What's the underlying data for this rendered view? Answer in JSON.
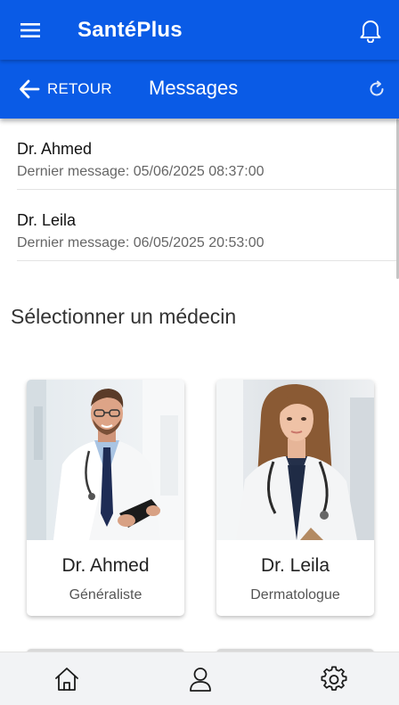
{
  "app": {
    "title": "SantéPlus",
    "icons": {
      "menu": "hamburger-menu-icon",
      "notifications": "bell-icon"
    }
  },
  "header": {
    "back_label": "RETOUR",
    "title": "Messages",
    "icons": {
      "back": "arrow-left-icon",
      "refresh": "refresh-icon"
    }
  },
  "conversations": [
    {
      "name": "Dr. Ahmed",
      "last_message": "Dernier message: 05/06/2025 08:37:00"
    },
    {
      "name": "Dr. Leila",
      "last_message": "Dernier message: 06/05/2025 20:53:00"
    }
  ],
  "doctor_section": {
    "title": "Sélectionner un médecin",
    "doctors": [
      {
        "name": "Dr. Ahmed",
        "specialty": "Généraliste"
      },
      {
        "name": "Dr. Leila",
        "specialty": "Dermatologue"
      }
    ]
  },
  "bottom_nav": [
    {
      "icon": "home-icon"
    },
    {
      "icon": "user-icon"
    },
    {
      "icon": "gear-icon"
    }
  ],
  "colors": {
    "primary": "#0a5be6",
    "background": "#ffffff",
    "nav_background": "#f2f3f5",
    "muted_text": "#666666"
  }
}
